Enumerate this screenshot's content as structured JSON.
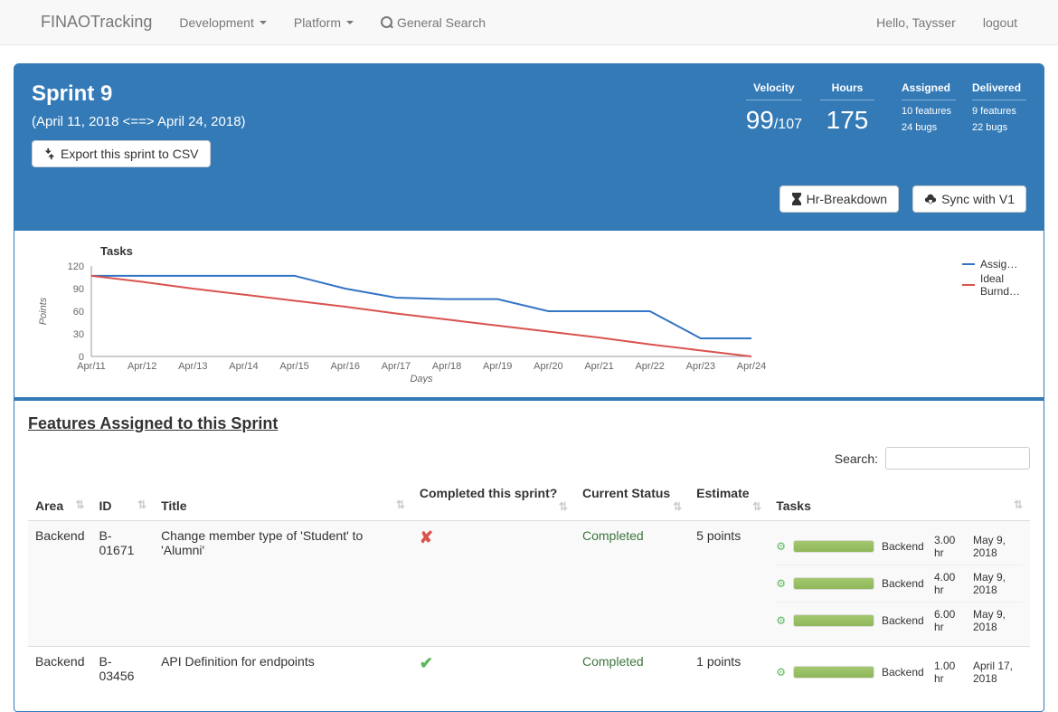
{
  "nav": {
    "brand": "FINAOTracking",
    "development": "Development",
    "platform": "Platform",
    "general_search": "General Search",
    "hello": "Hello, Taysser",
    "logout": "logout"
  },
  "sprint": {
    "title": "Sprint 9",
    "dates": "(April 11, 2018 <==> April 24, 2018)",
    "export_btn": "Export this sprint to CSV",
    "hr_breakdown_btn": "Hr-Breakdown",
    "sync_btn": "Sync with V1"
  },
  "stats": {
    "velocity_label": "Velocity",
    "velocity_done": "99",
    "velocity_total": "/107",
    "hours_label": "Hours",
    "hours_value": "175",
    "assigned_label": "Assigned",
    "assigned_features": "10 features",
    "assigned_bugs": "24 bugs",
    "delivered_label": "Delivered",
    "delivered_features": "9 features",
    "delivered_bugs": "22 bugs"
  },
  "chart_data": {
    "type": "line",
    "title": "Tasks",
    "xlabel": "Days",
    "ylabel": "Points",
    "categories": [
      "Apr/11",
      "Apr/12",
      "Apr/13",
      "Apr/14",
      "Apr/15",
      "Apr/16",
      "Apr/17",
      "Apr/18",
      "Apr/19",
      "Apr/20",
      "Apr/21",
      "Apr/22",
      "Apr/23",
      "Apr/24"
    ],
    "yticks": [
      0,
      30,
      60,
      90,
      120
    ],
    "ylim": [
      0,
      120
    ],
    "series": [
      {
        "name": "Assig…",
        "color": "#3374c4",
        "values": [
          107,
          107,
          107,
          107,
          107,
          90,
          78,
          76,
          76,
          60,
          60,
          60,
          24,
          24
        ]
      },
      {
        "name": "Ideal Burnd…",
        "color": "#d9534f",
        "values": [
          107,
          99,
          90,
          82,
          74,
          66,
          57,
          49,
          41,
          33,
          25,
          16,
          8,
          0
        ]
      }
    ]
  },
  "features": {
    "section_title": "Features Assigned to this Sprint",
    "search_label": "Search:",
    "columns": {
      "area": "Area",
      "id": "ID",
      "title": "Title",
      "completed": "Completed this sprint?",
      "status": "Current Status",
      "estimate": "Estimate",
      "tasks": "Tasks"
    },
    "rows": [
      {
        "area": "Backend",
        "id": "B-01671",
        "title": "Change member type of 'Student' to 'Alumni'",
        "completed": false,
        "status": "Completed",
        "estimate": "5 points",
        "tasks": [
          {
            "area": "Backend",
            "hr": "3.00 hr",
            "date": "May 9, 2018"
          },
          {
            "area": "Backend",
            "hr": "4.00 hr",
            "date": "May 9, 2018"
          },
          {
            "area": "Backend",
            "hr": "6.00 hr",
            "date": "May 9, 2018"
          }
        ]
      },
      {
        "area": "Backend",
        "id": "B-03456",
        "title": "API Definition for endpoints",
        "completed": true,
        "status": "Completed",
        "estimate": "1 points",
        "tasks": [
          {
            "area": "Backend",
            "hr": "1.00 hr",
            "date": "April 17, 2018"
          }
        ]
      }
    ]
  }
}
